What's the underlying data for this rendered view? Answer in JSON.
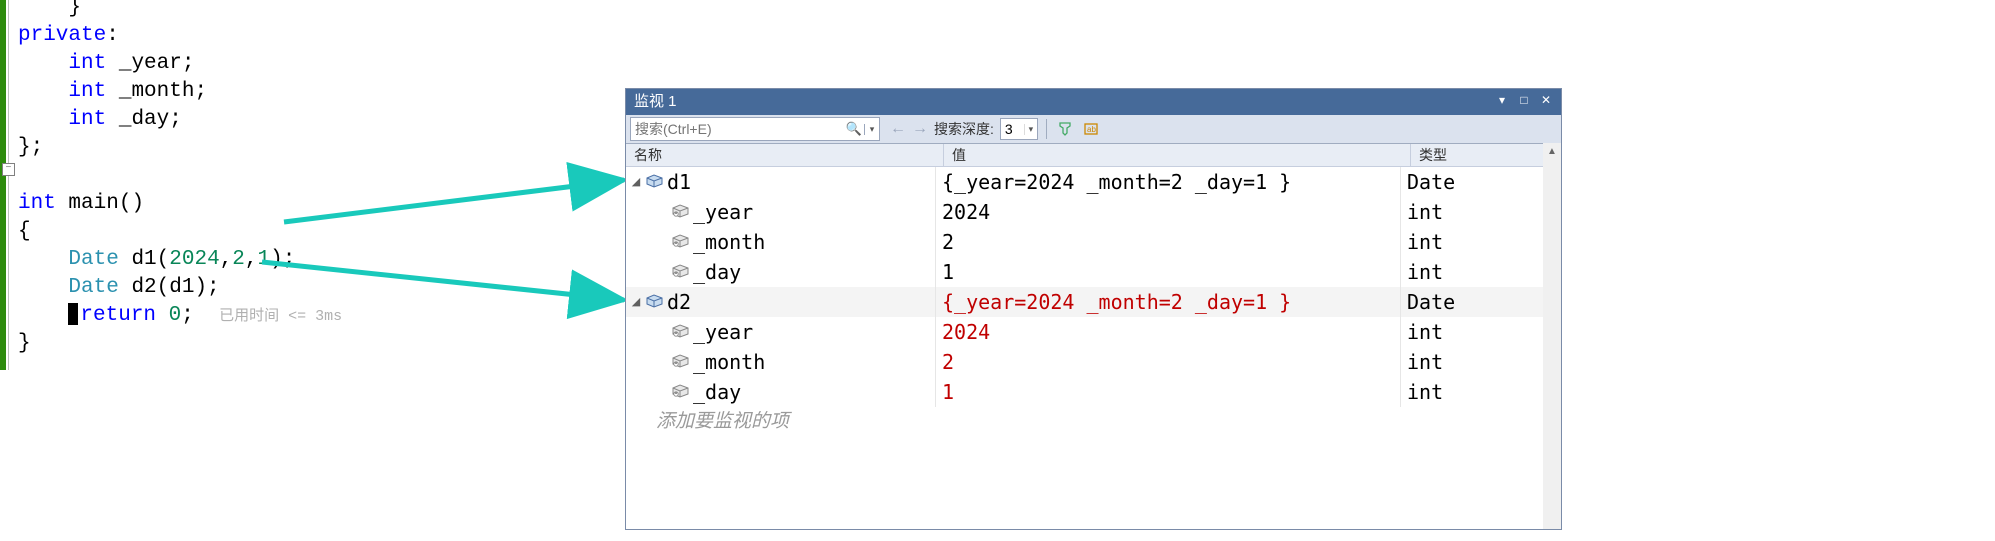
{
  "code": {
    "lines": [
      {
        "indent": 0,
        "html": "    }"
      },
      {
        "indent": 0,
        "html": "<span class='kw'>private</span>:"
      },
      {
        "indent": 0,
        "html": "    <span class='kw'>int</span> _year;"
      },
      {
        "indent": 0,
        "html": "    <span class='kw'>int</span> _month;"
      },
      {
        "indent": 0,
        "html": "    <span class='kw'>int</span> _day;"
      },
      {
        "indent": 0,
        "html": "};"
      },
      {
        "indent": 0,
        "html": ""
      },
      {
        "indent": 0,
        "html": "<span class='kw'>int</span> <span class='op'>main</span>()"
      },
      {
        "indent": 0,
        "html": "{"
      },
      {
        "indent": 0,
        "html": "    <span class='ty'>Date</span> d1(<span class='num'>2024</span>,<span class='num'>2</span>,<span class='num'>1</span>);"
      },
      {
        "indent": 0,
        "html": "    <span class='ty'>Date</span> d2(d1);"
      },
      {
        "indent": 0,
        "html": "    <span class='cursor-block'></span><span class='kw'>return</span> <span class='num'>0</span>;  <span class='comment'>已用时间 &lt;= 3ms</span>"
      },
      {
        "indent": 0,
        "html": "}"
      }
    ]
  },
  "watch": {
    "title": "监视 1",
    "search_placeholder": "搜索(Ctrl+E)",
    "depth_label": "搜索深度:",
    "depth_value": "3",
    "columns": {
      "name": "名称",
      "value": "值",
      "type": "类型"
    },
    "rows": [
      {
        "kind": "struct",
        "name": "d1",
        "value": "{_year=2024 _month=2 _day=1 }",
        "type": "Date",
        "red": false,
        "alt": false
      },
      {
        "kind": "field",
        "name": "_year",
        "value": "2024",
        "type": "int",
        "red": false,
        "alt": false
      },
      {
        "kind": "field",
        "name": "_month",
        "value": "2",
        "type": "int",
        "red": false,
        "alt": false
      },
      {
        "kind": "field",
        "name": "_day",
        "value": "1",
        "type": "int",
        "red": false,
        "alt": false
      },
      {
        "kind": "struct",
        "name": "d2",
        "value": "{_year=2024 _month=2 _day=1 }",
        "type": "Date",
        "red": true,
        "alt": true
      },
      {
        "kind": "field",
        "name": "_year",
        "value": "2024",
        "type": "int",
        "red": true,
        "alt": false
      },
      {
        "kind": "field",
        "name": "_month",
        "value": "2",
        "type": "int",
        "red": true,
        "alt": false
      },
      {
        "kind": "field",
        "name": "_day",
        "value": "1",
        "type": "int",
        "red": true,
        "alt": false
      }
    ],
    "add_placeholder": "添加要监视的项"
  },
  "colors": {
    "arrow": "#19c9bb"
  }
}
